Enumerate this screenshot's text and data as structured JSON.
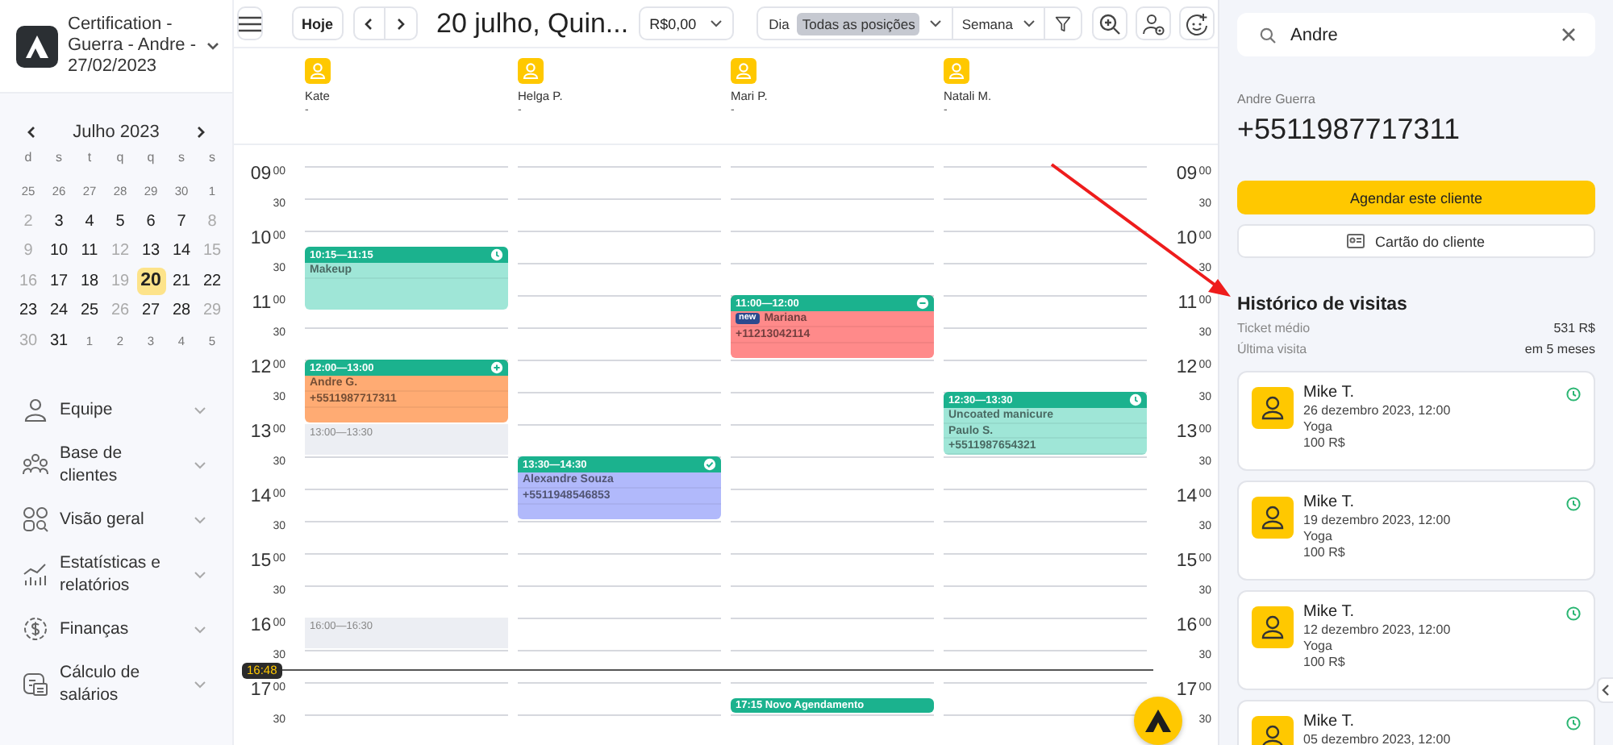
{
  "sidebar": {
    "business": "Certification - Guerra - Andre - 27/02/2023",
    "calendar": {
      "month": "Julho 2023",
      "weekdays": [
        "d",
        "s",
        "t",
        "q",
        "q",
        "s",
        "s"
      ],
      "weeks": [
        [
          {
            "text": "25",
            "kind": "adjacent",
            "selected": false
          },
          {
            "text": "26",
            "kind": "adjacent",
            "selected": false
          },
          {
            "text": "27",
            "kind": "adjacent",
            "selected": false
          },
          {
            "text": "28",
            "kind": "adjacent",
            "selected": false
          },
          {
            "text": "29",
            "kind": "adjacent",
            "selected": false
          },
          {
            "text": "30",
            "kind": "adjacent",
            "selected": false
          },
          {
            "text": "1",
            "kind": "adjacent",
            "selected": false
          }
        ],
        [
          {
            "text": "2",
            "kind": "off",
            "selected": false
          },
          {
            "text": "3",
            "kind": "day",
            "selected": false
          },
          {
            "text": "4",
            "kind": "day",
            "selected": false
          },
          {
            "text": "5",
            "kind": "day",
            "selected": false
          },
          {
            "text": "6",
            "kind": "day",
            "selected": false
          },
          {
            "text": "7",
            "kind": "day",
            "selected": false
          },
          {
            "text": "8",
            "kind": "off",
            "selected": false
          }
        ],
        [
          {
            "text": "9",
            "kind": "off",
            "selected": false
          },
          {
            "text": "10",
            "kind": "day",
            "selected": false
          },
          {
            "text": "11",
            "kind": "day",
            "selected": false
          },
          {
            "text": "12",
            "kind": "off",
            "selected": false
          },
          {
            "text": "13",
            "kind": "day",
            "selected": false
          },
          {
            "text": "14",
            "kind": "day",
            "selected": false
          },
          {
            "text": "15",
            "kind": "off",
            "selected": false
          }
        ],
        [
          {
            "text": "16",
            "kind": "off",
            "selected": false
          },
          {
            "text": "17",
            "kind": "day",
            "selected": false
          },
          {
            "text": "18",
            "kind": "day",
            "selected": false
          },
          {
            "text": "19",
            "kind": "off",
            "selected": false
          },
          {
            "text": "20",
            "kind": "day",
            "selected": true
          },
          {
            "text": "21",
            "kind": "day",
            "selected": false
          },
          {
            "text": "22",
            "kind": "day",
            "selected": false
          }
        ],
        [
          {
            "text": "23",
            "kind": "day",
            "selected": false
          },
          {
            "text": "24",
            "kind": "day",
            "selected": false
          },
          {
            "text": "25",
            "kind": "day",
            "selected": false
          },
          {
            "text": "26",
            "kind": "off",
            "selected": false
          },
          {
            "text": "27",
            "kind": "day",
            "selected": false
          },
          {
            "text": "28",
            "kind": "day",
            "selected": false
          },
          {
            "text": "29",
            "kind": "off",
            "selected": false
          }
        ],
        [
          {
            "text": "30",
            "kind": "off",
            "selected": false
          },
          {
            "text": "31",
            "kind": "day",
            "selected": false
          },
          {
            "text": "1",
            "kind": "adjacent",
            "selected": false
          },
          {
            "text": "2",
            "kind": "adjacent",
            "selected": false
          },
          {
            "text": "3",
            "kind": "adjacent",
            "selected": false
          },
          {
            "text": "4",
            "kind": "adjacent",
            "selected": false
          },
          {
            "text": "5",
            "kind": "adjacent",
            "selected": false
          }
        ]
      ]
    },
    "nav": [
      {
        "label": "Equipe"
      },
      {
        "label": "Base de clientes"
      },
      {
        "label": "Visão geral"
      },
      {
        "label": "Estatísticas e relatórios"
      },
      {
        "label": "Finanças"
      },
      {
        "label": "Cálculo de salários"
      }
    ]
  },
  "toolbar": {
    "today": "Hoje",
    "title": "20 julho, Quin...",
    "amount": "R$0,00",
    "view_options": [
      {
        "label": "Dia",
        "selected": false
      },
      {
        "label": "Todas as posições",
        "selected": true
      }
    ],
    "period": "Semana"
  },
  "times": [
    {
      "hour": "09",
      "minute": "00"
    },
    {
      "minute": "30"
    },
    {
      "hour": "10",
      "minute": "00"
    },
    {
      "minute": "30"
    },
    {
      "hour": "11",
      "minute": "00"
    },
    {
      "minute": "30"
    },
    {
      "hour": "12",
      "minute": "00"
    },
    {
      "minute": "30"
    },
    {
      "hour": "13",
      "minute": "00"
    },
    {
      "minute": "30"
    },
    {
      "hour": "14",
      "minute": "00"
    },
    {
      "minute": "30"
    },
    {
      "hour": "15",
      "minute": "00"
    },
    {
      "minute": "30"
    },
    {
      "hour": "16",
      "minute": "00"
    },
    {
      "minute": "30"
    },
    {
      "hour": "17",
      "minute": "00"
    },
    {
      "minute": "30"
    }
  ],
  "times_right": [
    {
      "hour": "09",
      "minute": "00"
    },
    {
      "minute": "30"
    },
    {
      "hour": "10",
      "minute": "00"
    },
    {
      "minute": "30"
    },
    {
      "hour": "11",
      "minute": "00"
    },
    {
      "minute": "30"
    },
    {
      "hour": "12",
      "minute": "00"
    },
    {
      "minute": "30"
    },
    {
      "hour": "13",
      "minute": "00"
    },
    {
      "minute": "30"
    },
    {
      "hour": "14",
      "minute": "00"
    },
    {
      "minute": "30"
    },
    {
      "hour": "15",
      "minute": "00"
    },
    {
      "minute": "30"
    },
    {
      "hour": "16",
      "minute": "00"
    },
    {
      "minute": "30"
    },
    {
      "hour": "17",
      "minute": "00"
    },
    {
      "minute": "30"
    }
  ],
  "now": "16:48",
  "staff": [
    {
      "name": "Kate",
      "position": "-",
      "events": [
        {
          "kind": "appointment",
          "time": "10:15—11:15",
          "color": "#9fe6d7",
          "status": {
            "kind": "waiting"
          },
          "lines": [
            "Makeup"
          ]
        },
        {
          "kind": "appointment",
          "time": "12:00—13:00",
          "color": "#ffab73",
          "status": {
            "kind": "arrived"
          },
          "lines": [
            "Andre G.",
            "+5511987717311"
          ]
        },
        {
          "kind": "break",
          "time": "13:00—13:30"
        },
        {
          "kind": "break",
          "time": "16:00—16:30"
        }
      ]
    },
    {
      "name": "Helga P.",
      "position": "-",
      "events": [
        {
          "kind": "appointment",
          "time": "13:30—14:30",
          "color": "#b1b9fb",
          "status": {
            "kind": "confirmed"
          },
          "lines": [
            "Alexandre Souza",
            "+5511948546853"
          ]
        }
      ]
    },
    {
      "name": "Mari P.",
      "position": "-",
      "events": [
        {
          "kind": "appointment",
          "time": "11:00—12:00",
          "color": "#ff8a8a",
          "status": {
            "kind": "no_show"
          },
          "badge": "new",
          "lines": [
            "Mariana",
            "+11213042114"
          ]
        },
        {
          "kind": "new",
          "time": "17:15",
          "title": "Novo Agendamento"
        }
      ]
    },
    {
      "name": "Natali M.",
      "position": "-",
      "events": [
        {
          "kind": "appointment",
          "time": "12:30—13:30",
          "color": "#9fe6d7",
          "status": {
            "kind": "waiting"
          },
          "lines": [
            "Uncoated manicure",
            "Paulo S.",
            "+5511987654321"
          ]
        }
      ]
    }
  ],
  "client_panel": {
    "search": {
      "value": "Andre"
    },
    "client": {
      "name": "Andre Guerra",
      "phone": "+5511987717311"
    },
    "primary_button": "Agendar este cliente",
    "card_button": "Cartão do cliente",
    "history": {
      "title": "Histórico de visitas",
      "stats": [
        {
          "label": "Ticket médio",
          "value": "531 R$"
        },
        {
          "label": "Última visita",
          "value": "em 5 meses"
        }
      ],
      "visits": [
        {
          "name": "Mike T.",
          "date": "26 dezembro 2023, 12:00",
          "service": "Yoga",
          "price": "100 R$"
        },
        {
          "name": "Mike T.",
          "date": "19 dezembro 2023, 12:00",
          "service": "Yoga",
          "price": "100 R$"
        },
        {
          "name": "Mike T.",
          "date": "12 dezembro 2023, 12:00",
          "service": "Yoga",
          "price": "100 R$"
        },
        {
          "name": "Mike T.",
          "date": "05 dezembro 2023, 12:00"
        }
      ]
    }
  }
}
